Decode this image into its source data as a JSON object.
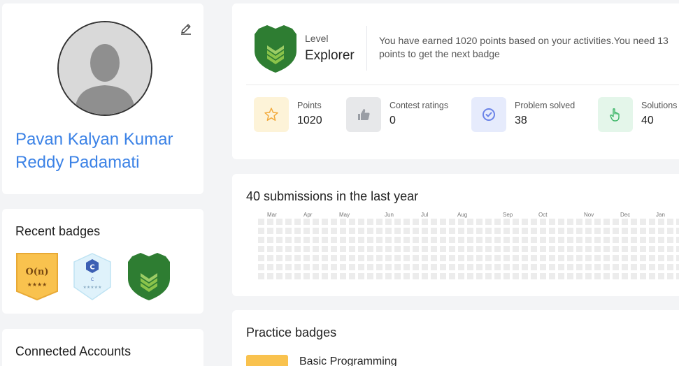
{
  "profile": {
    "name": "Pavan Kalyan Kumar Reddy Padamati"
  },
  "recent_badges": {
    "title": "Recent badges",
    "items": [
      {
        "icon": "big-o-badge-icon",
        "text": "O(n)",
        "stars": "★★★★"
      },
      {
        "icon": "c-language-badge-icon",
        "text": "C",
        "sub": "C",
        "stars": "★★★★★"
      },
      {
        "icon": "explorer-shield-icon"
      }
    ]
  },
  "connected_accounts": {
    "title": "Connected Accounts"
  },
  "level": {
    "label": "Level",
    "value": "Explorer",
    "message": "You have earned 1020 points based on your activities.You need 13",
    "message_line2": "points to get the next badge"
  },
  "stats": [
    {
      "label": "Points",
      "value": "1020",
      "icon": "star-icon",
      "bg": "#fdf3d8",
      "color": "#f2a93b"
    },
    {
      "label": "Contest ratings",
      "value": "0",
      "icon": "thumbs-up-icon",
      "bg": "#e7e8ea",
      "color": "#9a9ea5"
    },
    {
      "label": "Problem solved",
      "value": "38",
      "icon": "check-circle-icon",
      "bg": "#e6ebfc",
      "color": "#6b83e8"
    },
    {
      "label": "Solutions",
      "value": "40",
      "icon": "pointer-hand-icon",
      "bg": "#e4f6ea",
      "color": "#3fb76a"
    }
  ],
  "submissions": {
    "title": "40 submissions in the last year",
    "months": [
      "Mar",
      "Apr",
      "May",
      "Jun",
      "Jul",
      "Aug",
      "Sep",
      "Oct",
      "Nov",
      "Dec",
      "Jan"
    ]
  },
  "practice": {
    "title": "Practice badges",
    "items": [
      {
        "label": "Basic Programming"
      }
    ]
  },
  "colors": {
    "accent": "#3b82e6",
    "shield_green": "#2e7d32",
    "heat_empty": "#ececec"
  }
}
